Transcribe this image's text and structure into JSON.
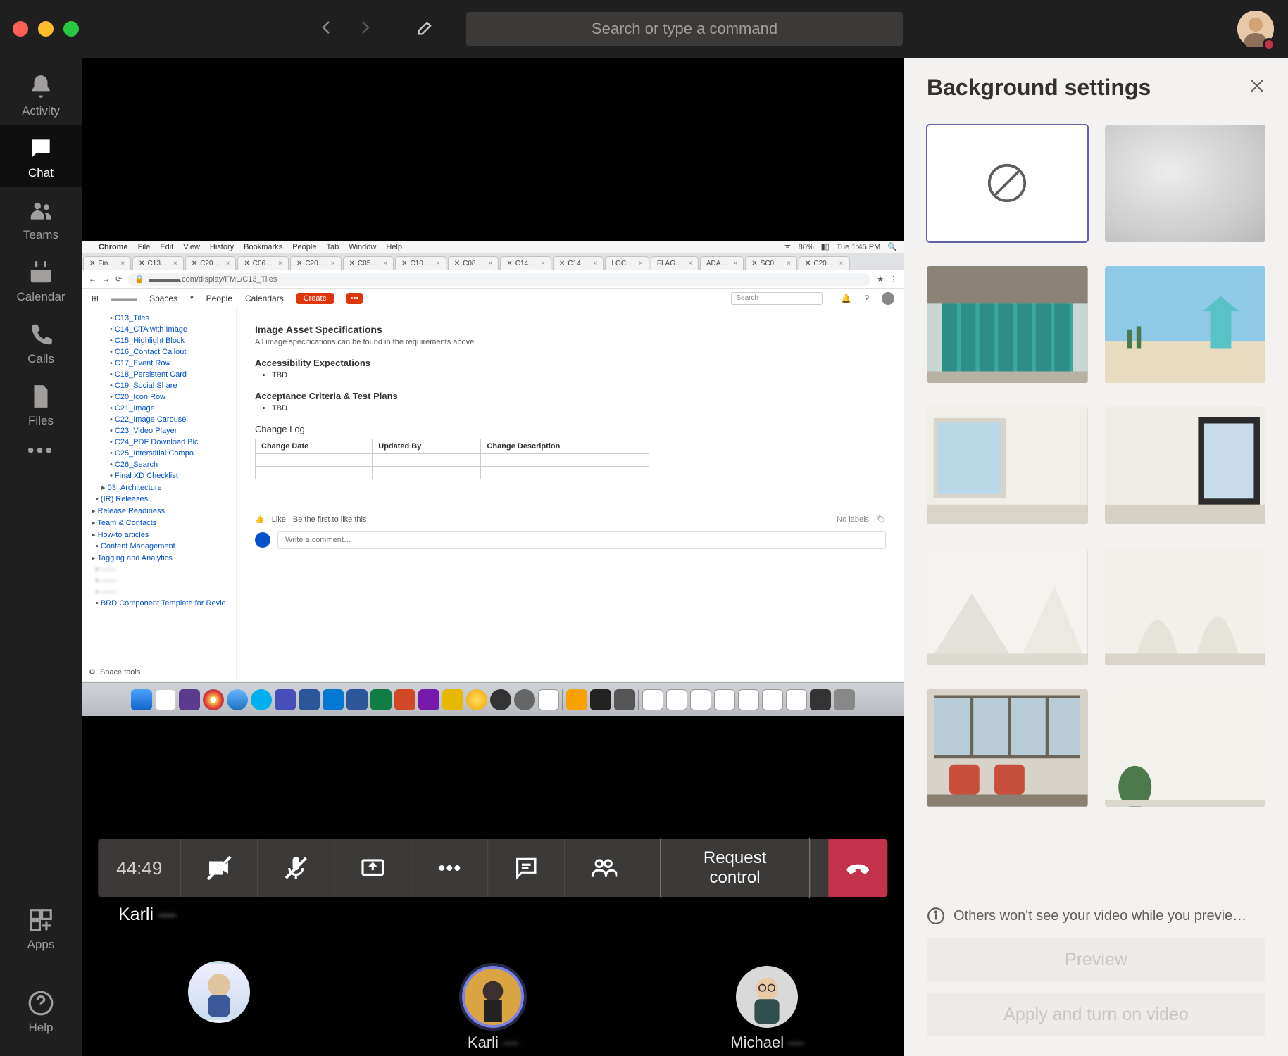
{
  "titlebar": {
    "search_placeholder": "Search or type a command"
  },
  "leftrail": {
    "items": [
      {
        "id": "activity",
        "label": "Activity"
      },
      {
        "id": "chat",
        "label": "Chat"
      },
      {
        "id": "teams",
        "label": "Teams"
      },
      {
        "id": "calendar",
        "label": "Calendar"
      },
      {
        "id": "calls",
        "label": "Calls"
      },
      {
        "id": "files",
        "label": "Files"
      }
    ],
    "more": "•••",
    "apps_label": "Apps",
    "help_label": "Help"
  },
  "call": {
    "timer": "44:49",
    "request_control": "Request control",
    "presenter_first": "Karli",
    "presenter_last": "—"
  },
  "participants": [
    {
      "name_first": "",
      "name_last": ""
    },
    {
      "name_first": "Karli",
      "name_last": "—"
    },
    {
      "name_first": "Michael",
      "name_last": "—"
    }
  ],
  "rightpanel": {
    "title": "Background settings",
    "info": "Others won't see your video while you previe…",
    "preview_btn": "Preview",
    "apply_btn": "Apply and turn on video",
    "tiles": [
      {
        "kind": "none",
        "selected": true,
        "name": "no-background"
      },
      {
        "kind": "blur",
        "name": "blur"
      },
      {
        "kind": "image",
        "name": "lockers"
      },
      {
        "kind": "image",
        "name": "beach"
      },
      {
        "kind": "image",
        "name": "room-window-left"
      },
      {
        "kind": "image",
        "name": "room-window-right"
      },
      {
        "kind": "image",
        "name": "white-studio-stairs"
      },
      {
        "kind": "image",
        "name": "white-studio-backdrop"
      },
      {
        "kind": "image",
        "name": "office-chairs"
      },
      {
        "kind": "image",
        "name": "plain-wall-plant"
      }
    ]
  },
  "shared": {
    "mac_menu": [
      "Chrome",
      "File",
      "Edit",
      "View",
      "History",
      "Bookmarks",
      "People",
      "Tab",
      "Window",
      "Help"
    ],
    "mac_status": {
      "wifi_pct": "80%",
      "clock": "Tue 1:45 PM"
    },
    "url": ".com/display/FML/C13_Tiles",
    "tabs": [
      "Fin…",
      "C13…",
      "C20…",
      "C06…",
      "C20…",
      "C05…",
      "C10…",
      "C08…",
      "C14…",
      "C14…",
      "LOC…",
      "FLAG…",
      "ADA…",
      "SC0…",
      "C20…"
    ],
    "conf_nav": {
      "spaces": "Spaces",
      "people": "People",
      "calendars": "Calendars",
      "create": "Create",
      "search_ph": "Search"
    },
    "tree": [
      "C13_Tiles",
      "C14_CTA with Image",
      "C15_Highlight Block",
      "C16_Contact Callout",
      "C17_Event Row",
      "C18_Persistent Card",
      "C19_Social Share",
      "C20_Icon Row",
      "C21_Image",
      "C22_Image Carousel",
      "C23_Video Player",
      "C24_PDF Download Blc",
      "C25_Interstitial Compo",
      "C26_Search",
      "Final XD Checklist"
    ],
    "tree2": [
      "03_Architecture",
      "(IR) Releases",
      "Release Readiness",
      "Team & Contacts",
      "How-to articles",
      "Content Management",
      "Tagging and Analytics",
      "——",
      "——",
      "——",
      "BRD Component Template for Revie"
    ],
    "space_tools": "Space tools",
    "content": {
      "h1": "Image Asset Specifications",
      "p1": "All image specifications can be found in the requirements above",
      "h2": "Accessibility Expectations",
      "b2": "TBD",
      "h3": "Acceptance Criteria & Test Plans",
      "b3": "TBD",
      "h4": "Change Log",
      "th1": "Change Date",
      "th2": "Updated By",
      "th3": "Change Description",
      "like": "Like",
      "like_hint": "Be the first to like this",
      "nolabels": "No labels",
      "comment_ph": "Write a comment…"
    }
  }
}
